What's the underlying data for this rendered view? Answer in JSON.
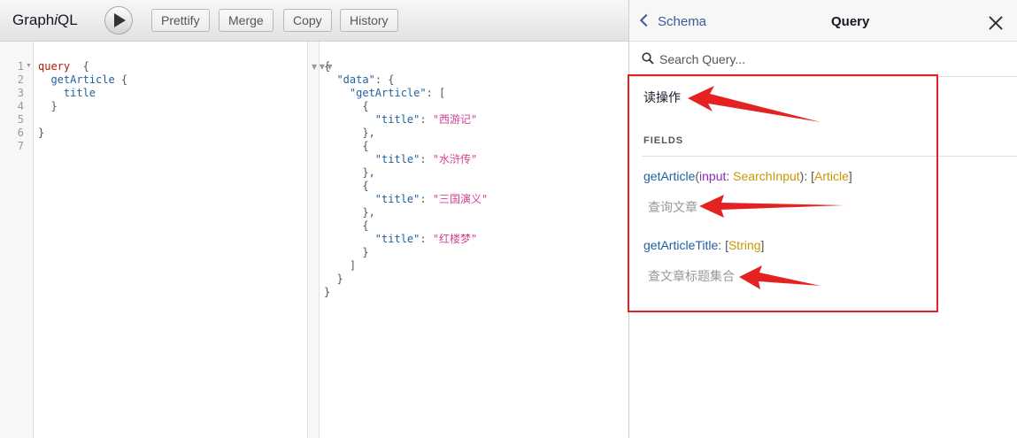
{
  "toolbar": {
    "logo_prefix": "Graph",
    "logo_i": "i",
    "logo_suffix": "QL",
    "prettify_label": "Prettify",
    "merge_label": "Merge",
    "copy_label": "Copy",
    "history_label": "History"
  },
  "query_editor": {
    "line_numbers": [
      "1",
      "2",
      "3",
      "4",
      "5",
      "6",
      "7"
    ],
    "keyword": "query",
    "field": "getArticle",
    "subfield": "title"
  },
  "result": {
    "data_key": "\"data\"",
    "query_key": "\"getArticle\"",
    "title_key": "\"title\"",
    "titles": [
      "\"西游记\"",
      "\"水浒传\"",
      "\"三国演义\"",
      "\"红楼梦\""
    ]
  },
  "docs": {
    "back_label": "Schema",
    "title": "Query",
    "search_placeholder": "Search Query...",
    "type_description": "读操作",
    "fields_heading": "FIELDS",
    "fields": [
      {
        "name": "getArticle",
        "arg_name": "input",
        "arg_type": "SearchInput",
        "return_type": "Article",
        "description": "查询文章"
      },
      {
        "name": "getArticleTitle",
        "return_type": "String",
        "description": "查文章标题集合"
      }
    ]
  },
  "colors": {
    "annotation": "#e52222",
    "field_name": "#1f61a0",
    "arg_name": "#8b2bb9",
    "type_name": "#ca9800",
    "string": "#d64292",
    "keyword": "#b11a04"
  }
}
